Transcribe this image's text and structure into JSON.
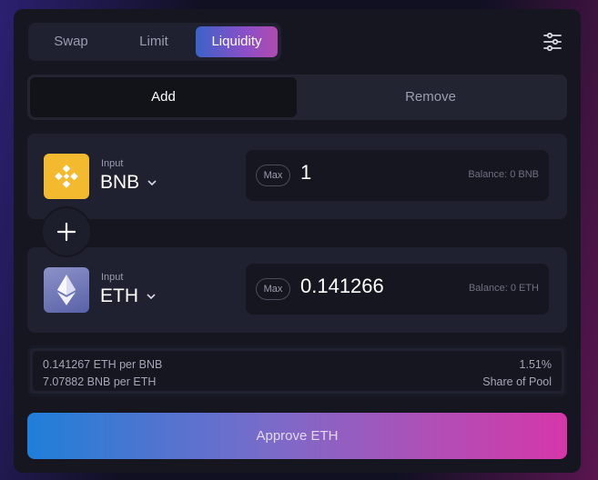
{
  "tabs": {
    "swap": "Swap",
    "limit": "Limit",
    "liquidity": "Liquidity"
  },
  "mode": {
    "add": "Add",
    "remove": "Remove"
  },
  "token1": {
    "label": "Input",
    "symbol": "BNB",
    "max": "Max",
    "amount": "1",
    "balance": "Balance: 0 BNB",
    "icon": "bnb-icon"
  },
  "token2": {
    "label": "Input",
    "symbol": "ETH",
    "max": "Max",
    "amount": "0.141266",
    "balance": "Balance: 0 ETH",
    "icon": "eth-icon"
  },
  "info": {
    "rate1": "0.141267 ETH per BNB",
    "rate2": "7.07882 BNB per ETH",
    "share_value": "1.51%",
    "share_label": "Share of Pool"
  },
  "approve_label": "Approve ETH",
  "colors": {
    "accent_start": "#1f7fd8",
    "accent_end": "#d636a8",
    "bnb": "#f3ba2f"
  }
}
